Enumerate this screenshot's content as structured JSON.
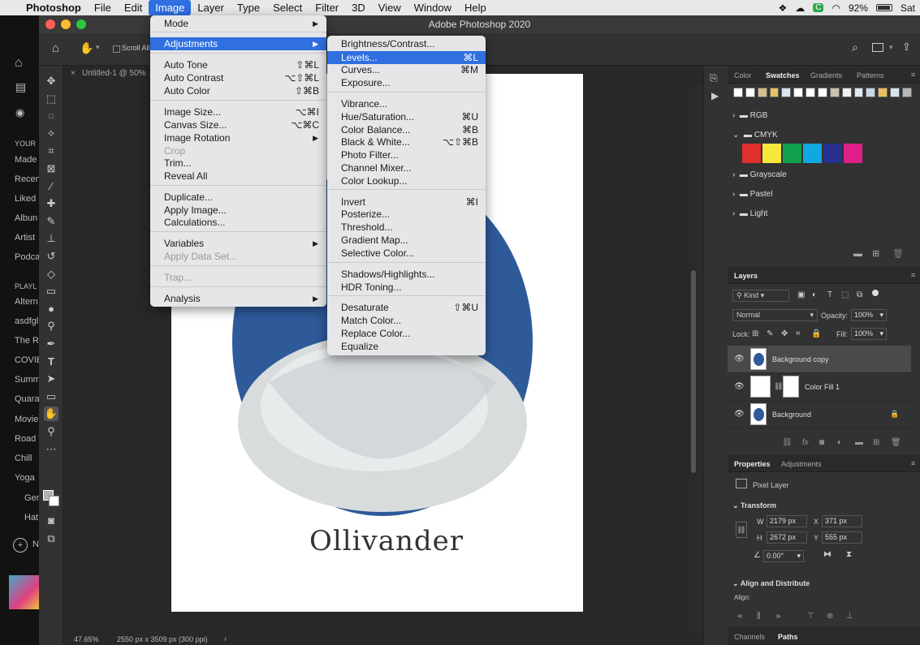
{
  "menubar": {
    "apple": "",
    "items": [
      "Photoshop",
      "File",
      "Edit",
      "Image",
      "Layer",
      "Type",
      "Select",
      "Filter",
      "3D",
      "View",
      "Window",
      "Help"
    ],
    "active_index": 3,
    "battery": "92%",
    "day": "Sat"
  },
  "bg_app": {
    "section_your": "YOUR",
    "items": [
      "Made",
      "Recen",
      "Liked",
      "Albun",
      "Artist",
      "Podca"
    ],
    "section_play": "PLAYL",
    "playlists": [
      "Altern",
      "asdfgl",
      "The R",
      "COVIE",
      "Summ",
      "Quara",
      "Movie",
      "Road T",
      "Chill",
      "Yoga",
      "Ger",
      "Hat"
    ],
    "new_label": "N"
  },
  "window": {
    "title": "Adobe Photoshop 2020",
    "doc_tab": "Untitled-1 @ 50%",
    "scroll_all": "Scroll All",
    "zoom": "47.65%",
    "doc_info": "2550 px x 3509 px (300 ppi)"
  },
  "document": {
    "caption": "Ollivander"
  },
  "image_menu": {
    "rows": [
      {
        "label": "Mode",
        "shortcut": "",
        "submenu": true
      },
      {
        "label": "Adjustments",
        "shortcut": "",
        "submenu": true,
        "selected": true
      },
      {
        "label": "Auto Tone",
        "shortcut": "⇧⌘L"
      },
      {
        "label": "Auto Contrast",
        "shortcut": "⌥⇧⌘L"
      },
      {
        "label": "Auto Color",
        "shortcut": "⇧⌘B"
      },
      {
        "label": "Image Size...",
        "shortcut": "⌥⌘I"
      },
      {
        "label": "Canvas Size...",
        "shortcut": "⌥⌘C"
      },
      {
        "label": "Image Rotation",
        "shortcut": "",
        "submenu": true
      },
      {
        "label": "Crop",
        "shortcut": "",
        "disabled": true
      },
      {
        "label": "Trim...",
        "shortcut": ""
      },
      {
        "label": "Reveal All",
        "shortcut": ""
      },
      {
        "label": "Duplicate...",
        "shortcut": ""
      },
      {
        "label": "Apply Image...",
        "shortcut": ""
      },
      {
        "label": "Calculations...",
        "shortcut": ""
      },
      {
        "label": "Variables",
        "shortcut": "",
        "submenu": true
      },
      {
        "label": "Apply Data Set...",
        "shortcut": "",
        "disabled": true
      },
      {
        "label": "Trap...",
        "shortcut": "",
        "disabled": true
      },
      {
        "label": "Analysis",
        "shortcut": "",
        "submenu": true
      }
    ]
  },
  "adjustments_menu": {
    "rows": [
      {
        "label": "Brightness/Contrast...",
        "shortcut": ""
      },
      {
        "label": "Levels...",
        "shortcut": "⌘L",
        "selected": true
      },
      {
        "label": "Curves...",
        "shortcut": "⌘M"
      },
      {
        "label": "Exposure...",
        "shortcut": ""
      },
      {
        "label": "Vibrance...",
        "shortcut": ""
      },
      {
        "label": "Hue/Saturation...",
        "shortcut": "⌘U"
      },
      {
        "label": "Color Balance...",
        "shortcut": "⌘B"
      },
      {
        "label": "Black & White...",
        "shortcut": "⌥⇧⌘B"
      },
      {
        "label": "Photo Filter...",
        "shortcut": ""
      },
      {
        "label": "Channel Mixer...",
        "shortcut": ""
      },
      {
        "label": "Color Lookup...",
        "shortcut": ""
      },
      {
        "label": "Invert",
        "shortcut": "⌘I"
      },
      {
        "label": "Posterize...",
        "shortcut": ""
      },
      {
        "label": "Threshold...",
        "shortcut": ""
      },
      {
        "label": "Gradient Map...",
        "shortcut": ""
      },
      {
        "label": "Selective Color...",
        "shortcut": ""
      },
      {
        "label": "Shadows/Highlights...",
        "shortcut": ""
      },
      {
        "label": "HDR Toning...",
        "shortcut": ""
      },
      {
        "label": "Desaturate",
        "shortcut": "⇧⌘U"
      },
      {
        "label": "Match Color...",
        "shortcut": ""
      },
      {
        "label": "Replace Color...",
        "shortcut": ""
      },
      {
        "label": "Equalize",
        "shortcut": ""
      }
    ]
  },
  "swatches_panel": {
    "tabs": [
      "Color",
      "Swatches",
      "Gradients",
      "Patterns"
    ],
    "active_tab": "Swatches",
    "top_colors": [
      "#ffffff",
      "#ffffff",
      "#d4c08a",
      "#e8c060",
      "#d8e4ee",
      "#ffffff",
      "#ffffff",
      "#ffffff",
      "#c8c0b0",
      "#f0f0f0",
      "#dde8f0",
      "#c8d8e8",
      "#e8c060",
      "#d8e4ee",
      "#b8b8b8"
    ],
    "groups": [
      "RGB",
      "CMYK",
      "Grayscale",
      "Pastel",
      "Light"
    ],
    "cmyk_colors": [
      "#e03030",
      "#f5e83a",
      "#10a050",
      "#10a8e0",
      "#283090",
      "#e0208a"
    ]
  },
  "layers_panel": {
    "title": "Layers",
    "kind": "Kind",
    "blend": "Normal",
    "opacity_label": "Opacity:",
    "opacity": "100%",
    "lock_label": "Lock:",
    "fill_label": "Fill:",
    "fill": "100%",
    "layers": [
      {
        "name": "Background copy",
        "selected": true
      },
      {
        "name": "Color Fill 1",
        "selected": false
      },
      {
        "name": "Background",
        "selected": false,
        "locked": true
      }
    ]
  },
  "properties_panel": {
    "tabs": [
      "Properties",
      "Adjustments"
    ],
    "kind": "Pixel Layer",
    "transform": "Transform",
    "w_label": "W",
    "w": "2179 px",
    "x_label": "X",
    "x": "371 px",
    "h_label": "H",
    "h": "2672 px",
    "y_label": "Y",
    "y": "555 px",
    "angle": "0.00°",
    "align": "Align and Distribute",
    "align_sub": "Align:"
  },
  "bottom_tabs": [
    "Channels",
    "Paths"
  ]
}
